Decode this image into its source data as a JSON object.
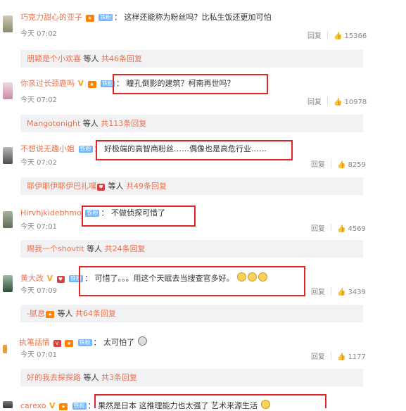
{
  "comments": [
    {
      "user": "巧克力甜心的亚子",
      "text": "这样还能称为粉丝吗？比私生饭还更加可怕",
      "time": "今天 07:02",
      "reply": "回复",
      "likes": "15366",
      "thread": {
        "name": "朋颖是个小欢喜",
        "suffix": " 等人 ",
        "count": "共46条回复"
      }
    },
    {
      "user": "你亲过长颈鹿吗",
      "text": "瞳孔倒影的建筑？柯南再世吗？",
      "time": "今天 07:02",
      "reply": "回复",
      "likes": "10978",
      "thread": {
        "name": "Mangotonight",
        "suffix": " 等人 ",
        "count": "共113条回复"
      }
    },
    {
      "user": "不想说无趣小姐",
      "text": "好极端的高智商粉丝……偶像也是高危行业……",
      "time": "今天 07:02",
      "reply": "回复",
      "likes": "8259",
      "thread": {
        "name": "耶伊耶伊耶伊巴扎嘿",
        "suffix": " 等人 ",
        "count": "共49条回复"
      }
    },
    {
      "user": "Hirvhjkidebhmo",
      "text": "不做侦探可惜了",
      "time": "今天 07:01",
      "reply": "回复",
      "likes": "4569",
      "thread": {
        "name": "赐我一个shovtit",
        "suffix": " 等人 ",
        "count": "共24条回复"
      }
    },
    {
      "user": "黄大改",
      "text": "可惜了。。。用这个天赋去当搜查官多好。",
      "time": "今天 07:09",
      "reply": "回复",
      "likes": "3439",
      "thread": {
        "name": "-腻息",
        "suffix": " 等人 ",
        "count": "共64条回复"
      }
    },
    {
      "user": "执笔話情",
      "text": "太可怕了",
      "time": "今天 07:01",
      "reply": "回复",
      "likes": "1177",
      "thread": {
        "name": "好的我去探探路",
        "suffix": " 等人 ",
        "count": "共3条回复"
      }
    },
    {
      "user": "carexo",
      "text": "果然是日本 这推理能力也太强了 艺术来源生活"
    }
  ],
  "badges": {
    "level": "铁粉",
    "vip": "V"
  },
  "colors": {
    "link": "#eb7350",
    "highlight": "#e0242a",
    "thread_bg": "#f2f2f5"
  }
}
